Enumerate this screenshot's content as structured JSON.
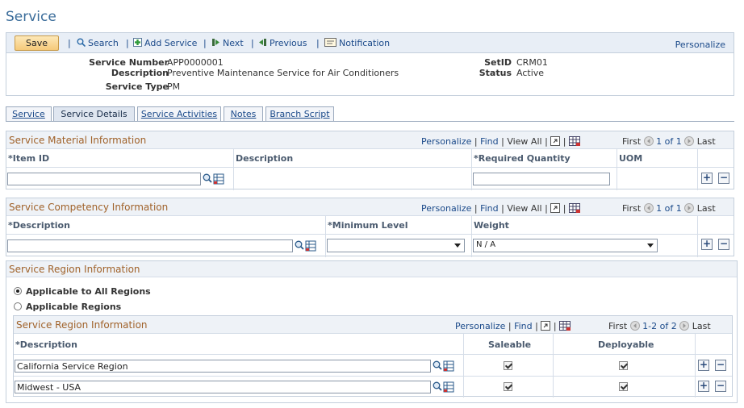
{
  "page": {
    "title": "Service"
  },
  "toolbar": {
    "save_label": "Save",
    "search_label": "Search",
    "add_label": "Add Service",
    "next_label": "Next",
    "previous_label": "Previous",
    "notification_label": "Notification",
    "personalize_label": "Personalize"
  },
  "header": {
    "service_number_label": "Service Number",
    "service_number_value": "APP0000001",
    "description_label": "Description",
    "description_value": "Preventive Maintenance Service for Air Conditioners",
    "service_type_label": "Service Type",
    "service_type_value": "PM",
    "setid_label": "SetID",
    "setid_value": "CRM01",
    "status_label": "Status",
    "status_value": "Active"
  },
  "tabs": [
    {
      "label": "Service",
      "active": false
    },
    {
      "label": "Service Details",
      "active": true
    },
    {
      "label": "Service Activities",
      "active": false
    },
    {
      "label": "Notes",
      "active": false
    },
    {
      "label": "Branch Script",
      "active": false
    }
  ],
  "grid_nav": {
    "personalize": "Personalize",
    "find": "Find",
    "view_all": "View All",
    "first": "First",
    "last": "Last"
  },
  "material": {
    "title": "Service Material Information",
    "range": "1 of 1",
    "col_item": "*Item ID",
    "col_desc": "Description",
    "col_qty": "*Required Quantity",
    "col_uom": "UOM",
    "row": {
      "item_id": "",
      "quantity": ""
    }
  },
  "competency": {
    "title": "Service Competency Information",
    "range": "1 of 1",
    "col_desc": "*Description",
    "col_min": "*Minimum Level",
    "col_weight": "Weight",
    "row": {
      "description": "",
      "min_level": "",
      "weight": "N / A"
    }
  },
  "region": {
    "title": "Service Region Information",
    "radio_all": "Applicable to All Regions",
    "radio_some": "Applicable Regions",
    "selected": "all",
    "grid_title": "Service Region Information",
    "range": "1-2 of 2",
    "col_desc": "*Description",
    "col_saleable": "Saleable",
    "col_deployable": "Deployable",
    "rows": [
      {
        "description": "California Service Region",
        "saleable": true,
        "deployable": true
      },
      {
        "description": "Midwest - USA",
        "saleable": true,
        "deployable": true
      }
    ]
  },
  "colors": {
    "section_title": "#a0622a",
    "link": "#1b4a8a",
    "title": "#3a6c9a"
  }
}
